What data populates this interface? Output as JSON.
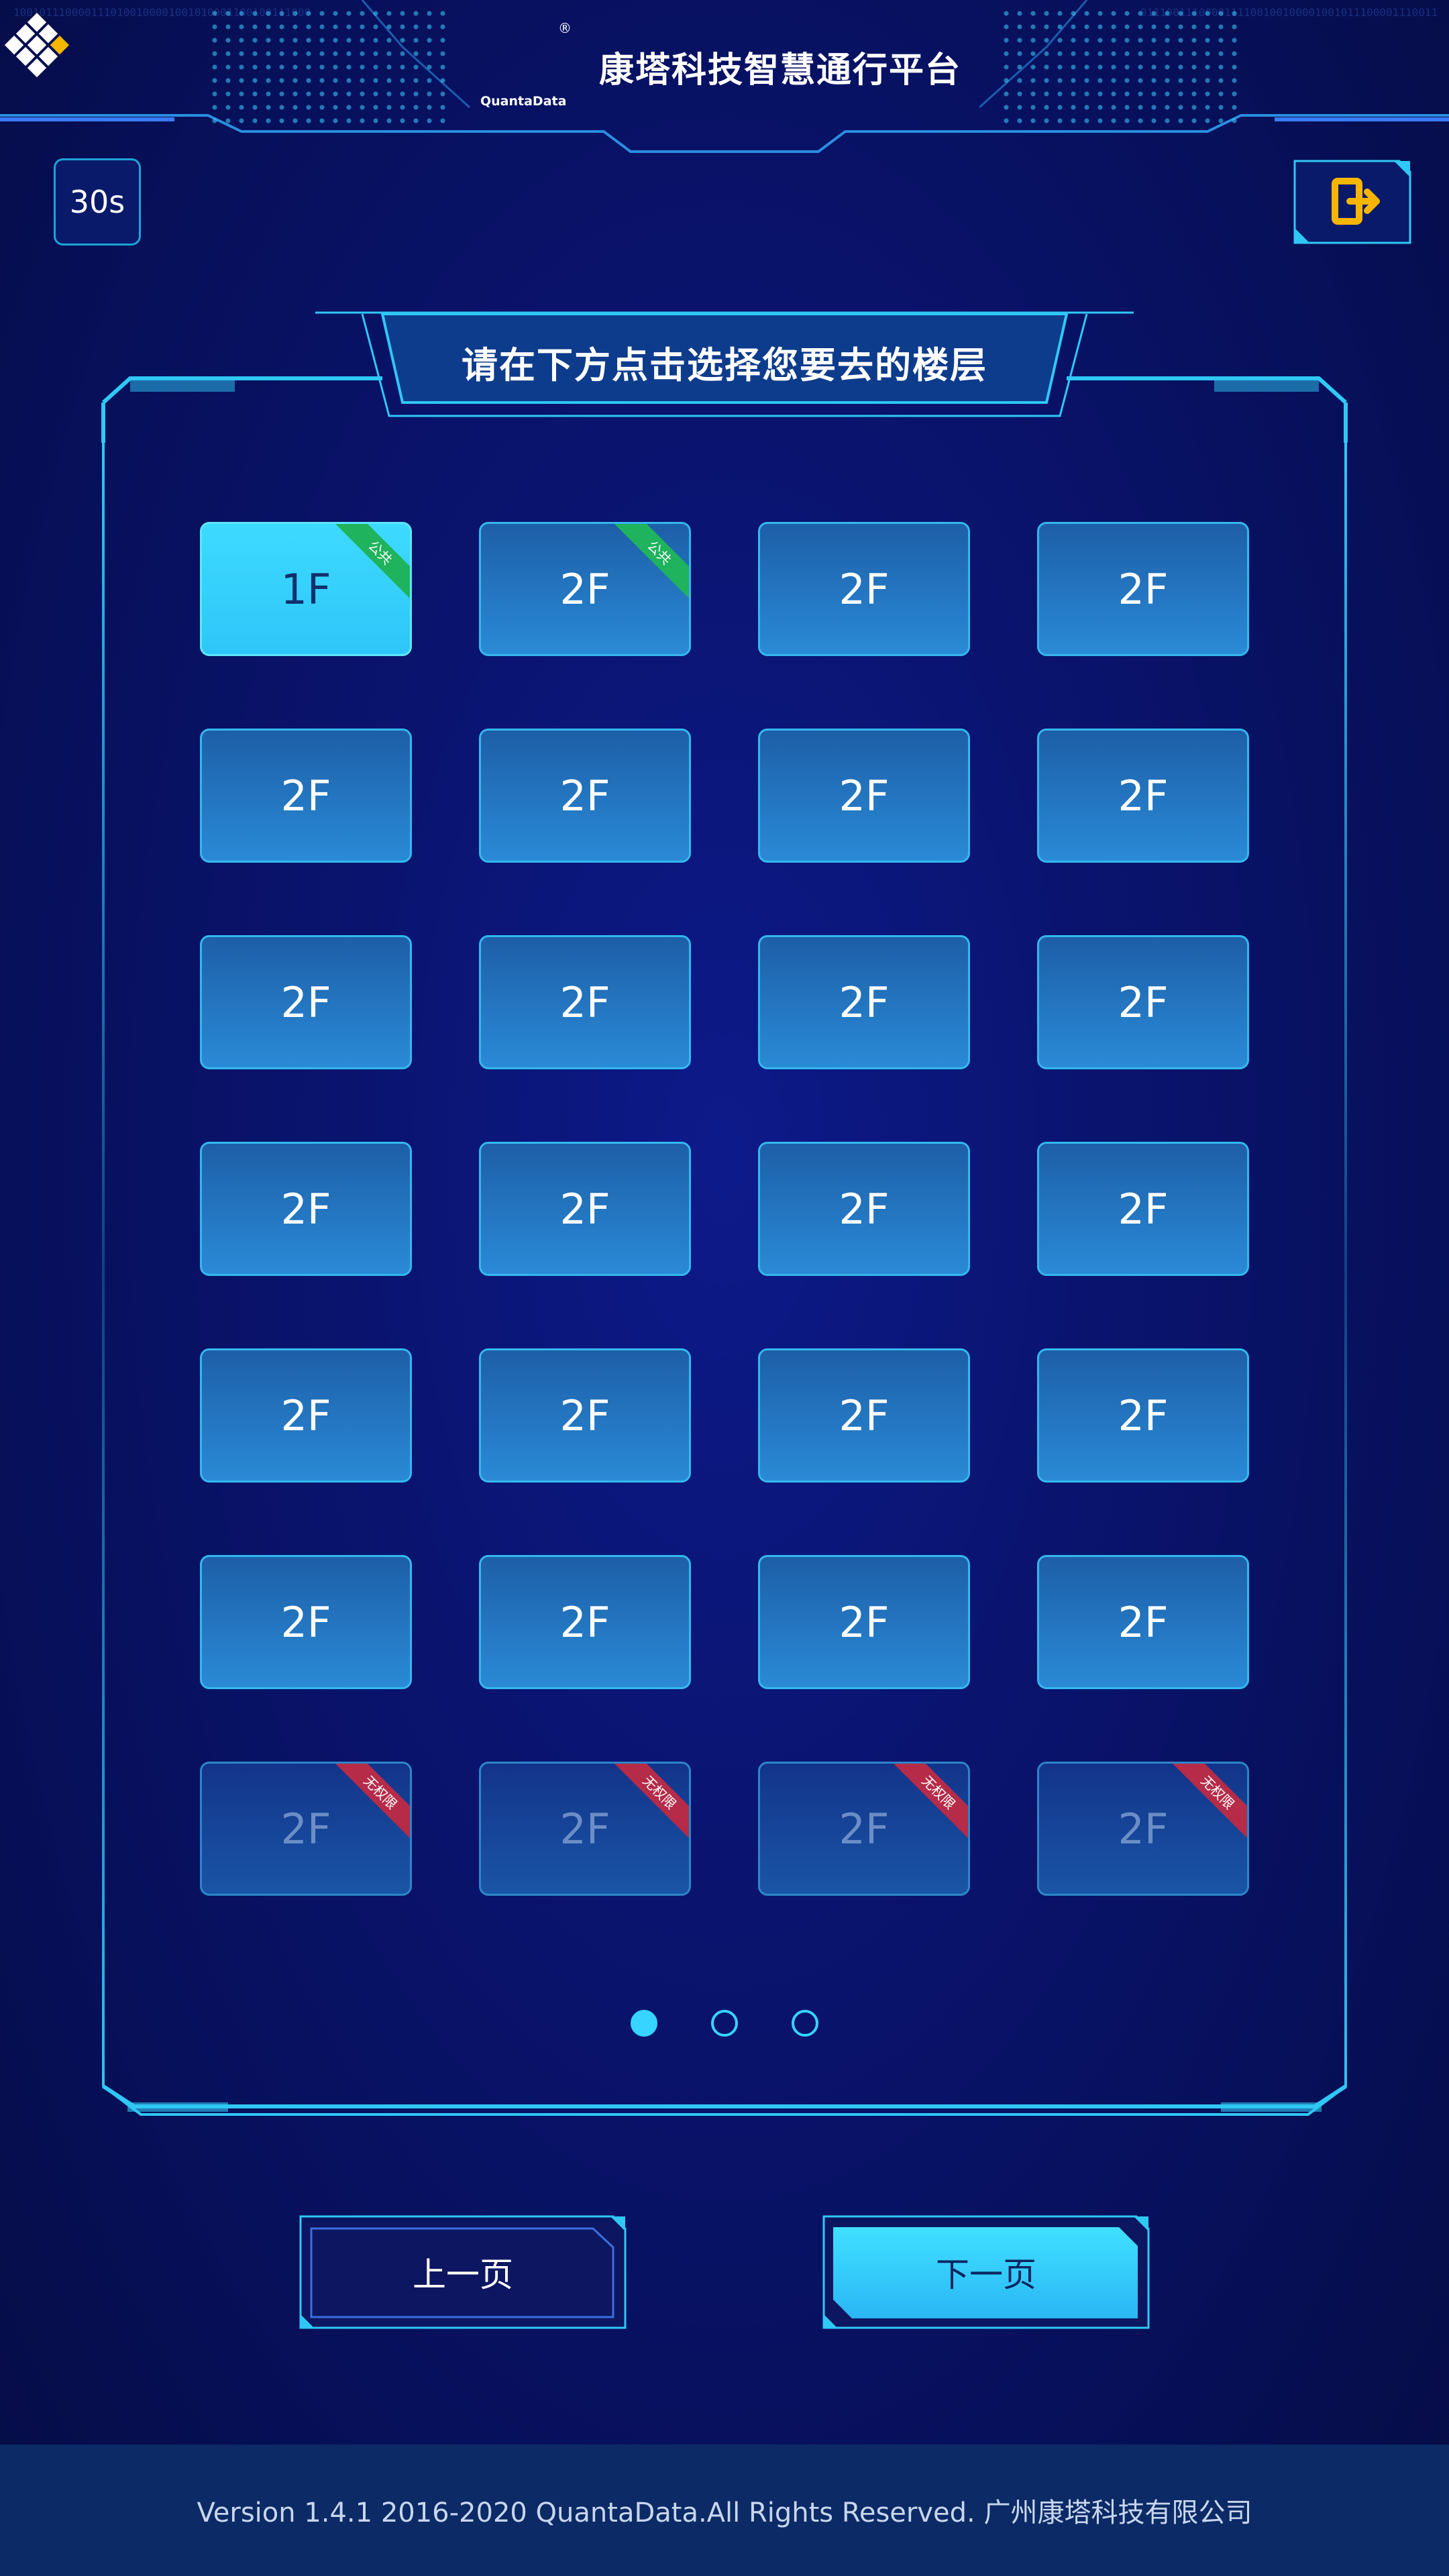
{
  "header": {
    "logo_text": "QuantaData",
    "title": "康塔科技智慧通行平台",
    "binary_left": "1001011100001110100100001001010001100100111000",
    "binary_right": "0111001110000111100100100001001011100001110011"
  },
  "timer": {
    "label": "30s"
  },
  "exit": {
    "icon": "exit-door-icon",
    "color": "#f7b500"
  },
  "banner": {
    "text": "请在下方点击选择您要去的楼层"
  },
  "floors": [
    {
      "label": "1F",
      "state": "selected",
      "tag": "公共"
    },
    {
      "label": "2F",
      "state": "normal",
      "tag": "公共"
    },
    {
      "label": "2F",
      "state": "normal",
      "tag": ""
    },
    {
      "label": "2F",
      "state": "normal",
      "tag": ""
    },
    {
      "label": "2F",
      "state": "normal",
      "tag": ""
    },
    {
      "label": "2F",
      "state": "normal",
      "tag": ""
    },
    {
      "label": "2F",
      "state": "normal",
      "tag": ""
    },
    {
      "label": "2F",
      "state": "normal",
      "tag": ""
    },
    {
      "label": "2F",
      "state": "normal",
      "tag": ""
    },
    {
      "label": "2F",
      "state": "normal",
      "tag": ""
    },
    {
      "label": "2F",
      "state": "normal",
      "tag": ""
    },
    {
      "label": "2F",
      "state": "normal",
      "tag": ""
    },
    {
      "label": "2F",
      "state": "normal",
      "tag": ""
    },
    {
      "label": "2F",
      "state": "normal",
      "tag": ""
    },
    {
      "label": "2F",
      "state": "normal",
      "tag": ""
    },
    {
      "label": "2F",
      "state": "normal",
      "tag": ""
    },
    {
      "label": "2F",
      "state": "normal",
      "tag": ""
    },
    {
      "label": "2F",
      "state": "normal",
      "tag": ""
    },
    {
      "label": "2F",
      "state": "normal",
      "tag": ""
    },
    {
      "label": "2F",
      "state": "normal",
      "tag": ""
    },
    {
      "label": "2F",
      "state": "normal",
      "tag": ""
    },
    {
      "label": "2F",
      "state": "normal",
      "tag": ""
    },
    {
      "label": "2F",
      "state": "normal",
      "tag": ""
    },
    {
      "label": "2F",
      "state": "normal",
      "tag": ""
    },
    {
      "label": "2F",
      "state": "disabled",
      "tag": "无权限"
    },
    {
      "label": "2F",
      "state": "disabled",
      "tag": "无权限"
    },
    {
      "label": "2F",
      "state": "disabled",
      "tag": "无权限"
    },
    {
      "label": "2F",
      "state": "disabled",
      "tag": "无权限"
    }
  ],
  "pagination": {
    "pages": 3,
    "current": 1
  },
  "nav": {
    "prev_label": "上一页",
    "next_label": "下一页"
  },
  "footer": {
    "text": "Version 1.4.1 2016-2020 QuantaData.All Rights Reserved. 广州康塔科技有限公司"
  },
  "colors": {
    "accent": "#36d4ff",
    "public_tag": "#1fb35e",
    "noperm_tag": "#b52b48",
    "background": "#0a1470"
  }
}
